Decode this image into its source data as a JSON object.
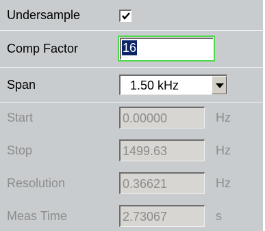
{
  "panel": {
    "undersample": {
      "label": "Undersample",
      "checked": true
    },
    "comp_factor": {
      "label": "Comp Factor",
      "value": "16"
    },
    "span": {
      "label": "Span",
      "value": "1.50 kHz"
    },
    "start": {
      "label": "Start",
      "value": "0.00000",
      "unit": "Hz"
    },
    "stop": {
      "label": "Stop",
      "value": "1499.63",
      "unit": "Hz"
    },
    "resolution": {
      "label": "Resolution",
      "value": "0.36621",
      "unit": "Hz"
    },
    "meas_time": {
      "label": "Meas Time",
      "value": "2.73067",
      "unit": "s"
    }
  },
  "colors": {
    "panel_bg": "#c9ccce",
    "focus_border": "#4cd94c",
    "selection": "#0a246a",
    "disabled_text": "#8c8c8c"
  },
  "icons": {
    "checkbox": "check-icon",
    "dropdown": "triangle-down-icon"
  }
}
